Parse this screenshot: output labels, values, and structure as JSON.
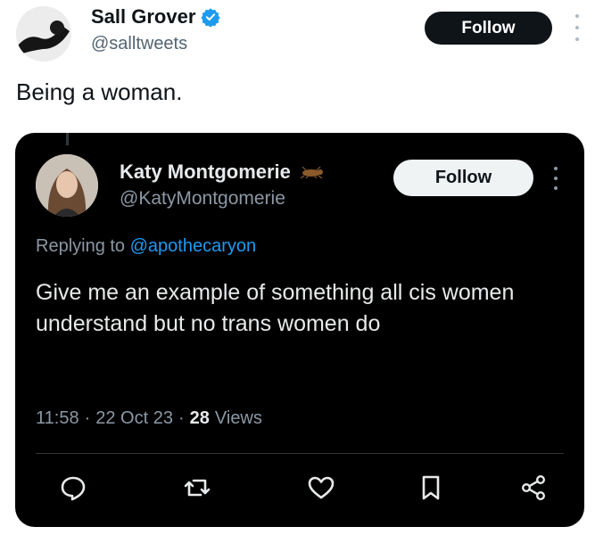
{
  "outer_tweet": {
    "author_name": "Sall Grover",
    "handle": "@salltweets",
    "follow_label": "Follow",
    "text": "Being a woman."
  },
  "quoted_tweet": {
    "author_name": "Katy Montgomerie",
    "handle": "@KatyMontgomerie",
    "follow_label": "Follow",
    "replying_prefix": "Replying to",
    "replying_to": "@apothecaryon",
    "text": "Give me an example of something all cis women understand but no trans women do",
    "time": "11:58",
    "separator": "·",
    "date": "22 Oct 23",
    "views_count": "28",
    "views_label": "Views"
  },
  "icons": {
    "verified": "verified-badge-icon",
    "reply": "reply-icon",
    "retweet": "retweet-icon",
    "like": "heart-icon",
    "bookmark": "bookmark-icon",
    "share": "share-icon"
  },
  "colors": {
    "verified_blue": "#1d9bf0",
    "mention_blue": "#1d9bf0",
    "card_bg": "#000000"
  }
}
